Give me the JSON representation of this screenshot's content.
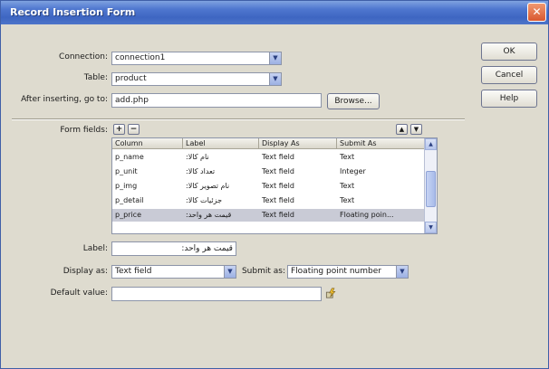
{
  "window": {
    "title": "Record Insertion Form"
  },
  "buttons": {
    "ok": "OK",
    "cancel": "Cancel",
    "help": "Help",
    "browse": "Browse..."
  },
  "form": {
    "connection": {
      "label": "Connection:",
      "value": "connection1"
    },
    "table": {
      "label": "Table:",
      "value": "product"
    },
    "after_inserting": {
      "label": "After inserting, go to:",
      "value": "add.php"
    },
    "form_fields_label": "Form fields:",
    "add_symbol": "+",
    "remove_symbol": "−",
    "up_symbol": "▲",
    "down_symbol": "▼"
  },
  "fields_table": {
    "columns": [
      "Column",
      "Label",
      "Display As",
      "Submit As"
    ],
    "rows": [
      {
        "column": "p_name",
        "label": "نام کالا:",
        "display_as": "Text field",
        "submit_as": "Text"
      },
      {
        "column": "p_unit",
        "label": "تعداد کالا:",
        "display_as": "Text field",
        "submit_as": "Integer"
      },
      {
        "column": "p_img",
        "label": "نام تصویر کالا:",
        "display_as": "Text field",
        "submit_as": "Text"
      },
      {
        "column": "p_detail",
        "label": "جزئیات کالا:",
        "display_as": "Text field",
        "submit_as": "Text"
      },
      {
        "column": "p_price",
        "label": "قیمت هر واحد:",
        "display_as": "Text field",
        "submit_as": "Floating poin..."
      }
    ],
    "selected_row_index": 4
  },
  "field_props": {
    "label": {
      "label": "Label:",
      "value": "قیمت هر واحد:"
    },
    "display_as": {
      "label": "Display as:",
      "value": "Text field"
    },
    "submit_as": {
      "label": "Submit as:",
      "value": "Floating point number"
    },
    "default_value": {
      "label": "Default value:",
      "value": ""
    }
  },
  "icons": {
    "close": "close-icon",
    "dropdown": "chevron-down-icon",
    "dynamic_data": "lightning-icon"
  },
  "colors": {
    "titlebar": "#4f77cf",
    "dialog_bg": "#dedbcf",
    "selected_row": "#c9cbd6"
  }
}
